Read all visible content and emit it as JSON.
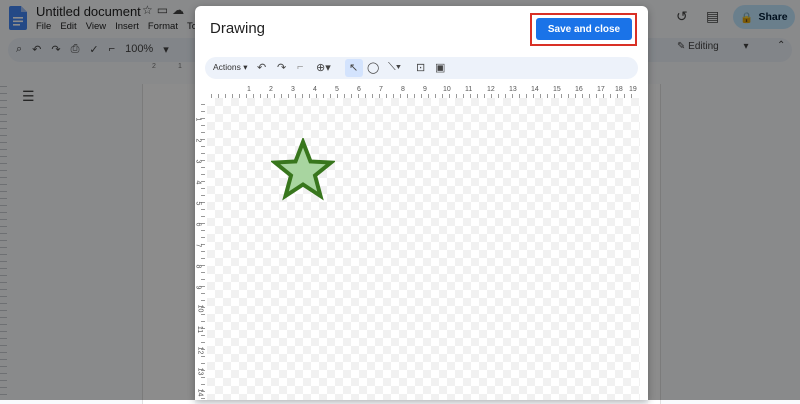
{
  "app": {
    "doc_title": "Untitled document",
    "menu": [
      "File",
      "Edit",
      "View",
      "Insert",
      "Format",
      "To"
    ],
    "share_label": "Share",
    "zoom": "100%",
    "mode": "Editing",
    "ruler_marks": [
      "2",
      "1"
    ]
  },
  "dialog": {
    "title": "Drawing",
    "save_label": "Save and close",
    "actions_label": "Actions",
    "h_ruler_labels": [
      "1",
      "2",
      "3",
      "4",
      "5",
      "6",
      "7",
      "8",
      "9",
      "10",
      "11",
      "12",
      "13",
      "14",
      "15",
      "16",
      "17",
      "18",
      "19"
    ],
    "v_ruler_labels": [
      "1",
      "2",
      "3",
      "4",
      "5",
      "6",
      "7",
      "8",
      "9",
      "10",
      "11",
      "12",
      "13",
      "14"
    ]
  },
  "colors": {
    "accent": "#1a73e8",
    "highlight": "#d93025",
    "star_fill": "#a8d5a0",
    "star_stroke": "#38761d",
    "share_bg": "#c2e7ff"
  }
}
